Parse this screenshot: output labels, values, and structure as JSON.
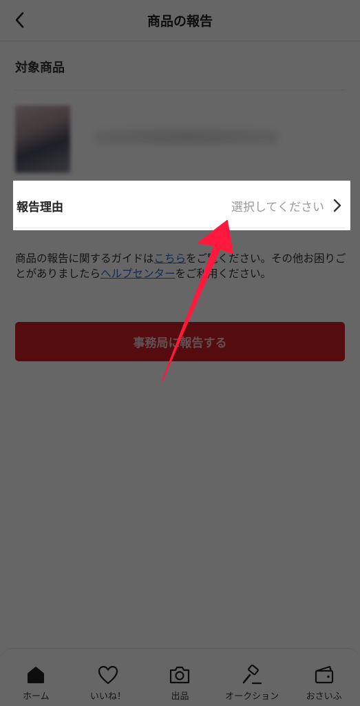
{
  "header": {
    "title": "商品の報告",
    "back_icon": "chevron-left-icon"
  },
  "target_section": {
    "title": "対象商品"
  },
  "reason": {
    "label": "報告理由",
    "placeholder": "選択してください",
    "chevron_icon": "chevron-right-icon"
  },
  "guide": {
    "text_1": "商品の報告に関するガイドは",
    "link_1": "こちら",
    "text_2": "をご覧ください。その他お困りごとがありましたら",
    "link_2": "ヘルプセンター",
    "text_3": "をご利用ください。"
  },
  "submit": {
    "label": "事務局に報告する",
    "color": "#d32027"
  },
  "bottom_nav": {
    "items": [
      {
        "label": "ホーム",
        "icon": "home-icon"
      },
      {
        "label": "いいね！",
        "icon": "heart-icon"
      },
      {
        "label": "出品",
        "icon": "camera-icon"
      },
      {
        "label": "オークション",
        "icon": "gavel-icon"
      },
      {
        "label": "おさいふ",
        "icon": "wallet-icon"
      }
    ]
  },
  "annotation": {
    "arrow_color": "#ff1a3d"
  }
}
